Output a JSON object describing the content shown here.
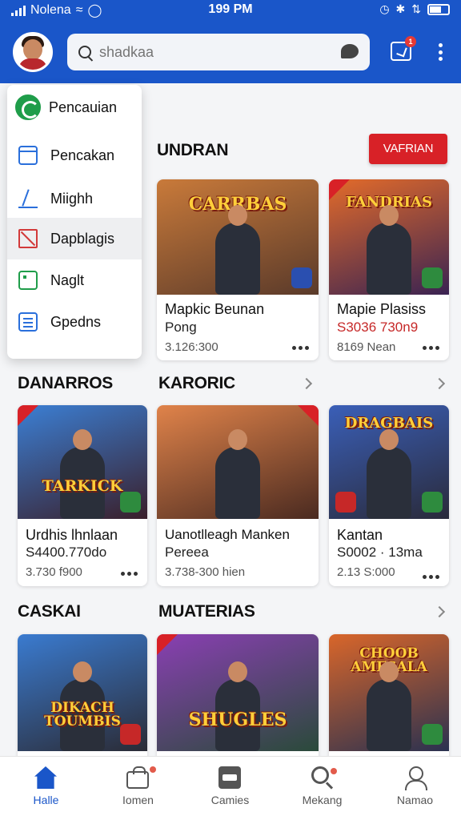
{
  "status_bar": {
    "carrier": "Nolena",
    "time": "199 PM"
  },
  "search": {
    "placeholder": "shadkaa"
  },
  "header": {
    "notification_count": "1"
  },
  "menu": {
    "items": [
      {
        "label": "Pencauian",
        "icon": "spinner-icon"
      },
      {
        "label": "Pencakan",
        "icon": "calendar-icon"
      },
      {
        "label": "Miighh",
        "icon": "shoe-icon"
      },
      {
        "label": "Dapblagis",
        "icon": "close-box-icon"
      },
      {
        "label": "Naglt",
        "icon": "note-icon"
      },
      {
        "label": "Gpedns",
        "icon": "list-icon"
      }
    ]
  },
  "sections": {
    "s1_title": "UNDRAN",
    "s1_button": "VAFRIAN",
    "s2_title": "DANARROS",
    "s3_title": "KARORIC",
    "s4_title": "CASKAI",
    "s5_title": "MUATERIAS"
  },
  "cards": [
    {
      "art": "CARRBAS",
      "name": "Mapkic Beunan",
      "sub": "Pong",
      "meta": "3.126:300",
      "colors": [
        "#c97a3a",
        "#5a3a2a"
      ]
    },
    {
      "art": "FANDRIAS",
      "name": "Mapie Plasiss",
      "sub": "S3036 730n9",
      "meta": "8169 Nean",
      "colors": [
        "#e36b2a",
        "#3a2352"
      ]
    },
    {
      "art": "TARKICK",
      "name": "Urdhis lhnlaan",
      "sub": "S4400.770do",
      "meta": "3.730 f900",
      "colors": [
        "#3b7fd4",
        "#3a1f2a"
      ]
    },
    {
      "art": "",
      "name": "Uanotlleagh Manken",
      "sub": "Pereea",
      "meta": "3.738-300 hien",
      "colors": [
        "#e0834a",
        "#4a2a20"
      ]
    },
    {
      "art": "DRAGBAIS",
      "name": "Kantan",
      "sub": "S0002 · 13ma",
      "meta": "2.13 S:000",
      "colors": [
        "#3a5fb8",
        "#2a2a3a"
      ]
    },
    {
      "art": "DIKACH TOUMBIS",
      "name": "",
      "sub": "",
      "meta": "",
      "colors": [
        "#3a7bd0",
        "#2b2b35"
      ]
    },
    {
      "art": "SHUGLES",
      "name": "",
      "sub": "",
      "meta": "",
      "colors": [
        "#8a3fb3",
        "#2a4a3a"
      ]
    },
    {
      "art": "CHOOB AMESALA",
      "name": "",
      "sub": "",
      "meta": "",
      "colors": [
        "#d9662a",
        "#2a3150"
      ]
    }
  ],
  "bottom_nav": [
    {
      "label": "Halle",
      "icon": "home-icon"
    },
    {
      "label": "Iomen",
      "icon": "shopping-bag-icon"
    },
    {
      "label": "Camies",
      "icon": "games-icon"
    },
    {
      "label": "Mekang",
      "icon": "search-icon"
    },
    {
      "label": "Namao",
      "icon": "user-icon"
    }
  ]
}
